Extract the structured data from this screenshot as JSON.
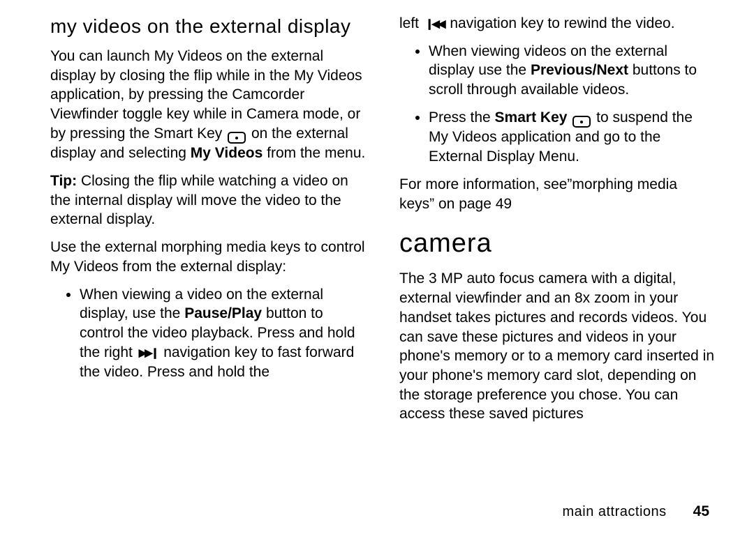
{
  "left": {
    "heading": "my videos on the external display",
    "para1_a": "You can launch My Videos on the external display by closing the flip while in the My Videos application, by pressing the Camcorder Viewfinder toggle key while in Camera mode, or by pressing the Smart Key ",
    "para1_b": " on the external display and selecting ",
    "my_videos": "My Videos",
    "para1_c": " from the menu.",
    "tip_label": "Tip:",
    "tip_text": " Closing the flip while watching a video on the internal display will move the video to the external display.",
    "para3": "Use the external morphing media keys to control My Videos from the external display:",
    "bullet1_a": "When viewing a video on the external display, use the ",
    "pause_play": "Pause/Play",
    "bullet1_b": " button to control the video playback. Press and hold the right ",
    "bullet1_c": " navigation key to fast forward the video. Press and hold the"
  },
  "right": {
    "cont_a": "left ",
    "cont_b": " navigation key to rewind the video.",
    "bullet2_a": "When viewing videos on the external display use the ",
    "prev_next": "Previous/Next",
    "bullet2_b": " buttons to scroll through available videos.",
    "bullet3_a": "Press the ",
    "smart_key": "Smart Key",
    "bullet3_b": " to suspend the My Videos application and go to the External Display Menu.",
    "para_more": "For more information, see”morphing media keys” on page 49",
    "camera_heading": "camera",
    "camera_para": "The 3 MP auto focus camera with a digital, external viewfinder and an 8x zoom in your handset takes pictures and records videos. You can save these pictures and videos in your phone's memory or to a memory card inserted in your phone's memory card slot, depending on the storage preference you chose. You can access these saved pictures"
  },
  "footer": {
    "section": "main attractions",
    "page": "45"
  },
  "icons": {
    "ff": "▶▶❙",
    "rw": "❙◀◀"
  }
}
